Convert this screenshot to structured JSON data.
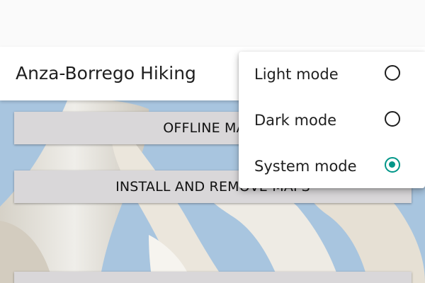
{
  "app_bar": {
    "title": "Anza-Borrego Hiking"
  },
  "buttons": {
    "offline_maps": "OFFLINE MAPS",
    "install_remove_maps": "INSTALL AND REMOVE MAPS"
  },
  "theme_menu": {
    "items": [
      {
        "label": "Light mode",
        "selected": false
      },
      {
        "label": "Dark mode",
        "selected": false
      },
      {
        "label": "System mode",
        "selected": true
      }
    ]
  },
  "colors": {
    "accent": "#009688",
    "sky": "#a7c4de",
    "button_bg": "#d9d7d9"
  }
}
